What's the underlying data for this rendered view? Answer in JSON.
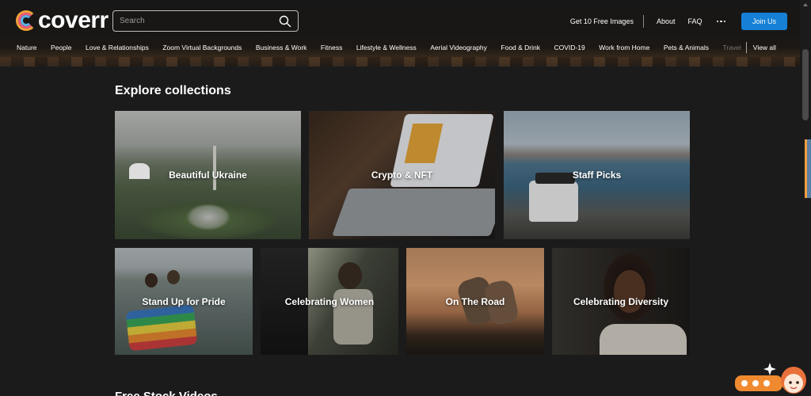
{
  "header": {
    "logo_text": "coverr",
    "search_placeholder": "Search",
    "links": [
      "Get 10 Free Images",
      "About",
      "FAQ"
    ],
    "join_label": "Join Us"
  },
  "categories": [
    "Nature",
    "People",
    "Love & Relationships",
    "Zoom Virtual Backgrounds",
    "Business & Work",
    "Fitness",
    "Lifestyle & Wellness",
    "Aerial Videography",
    "Food & Drink",
    "COVID-19",
    "Work from Home",
    "Pets & Animals",
    "Travel"
  ],
  "view_all_label": "View all",
  "collections": {
    "title": "Explore collections",
    "items": [
      {
        "label": "Beautiful Ukraine"
      },
      {
        "label": "Crypto & NFT"
      },
      {
        "label": "Staff Picks"
      },
      {
        "label": "Stand Up for Pride"
      },
      {
        "label": "Celebrating Women"
      },
      {
        "label": "On The Road"
      },
      {
        "label": "Celebrating Diversity"
      }
    ]
  },
  "next_section": {
    "title": "Free Stock Videos"
  },
  "colors": {
    "accent": "#1580d6",
    "background": "#1b1b1b"
  }
}
